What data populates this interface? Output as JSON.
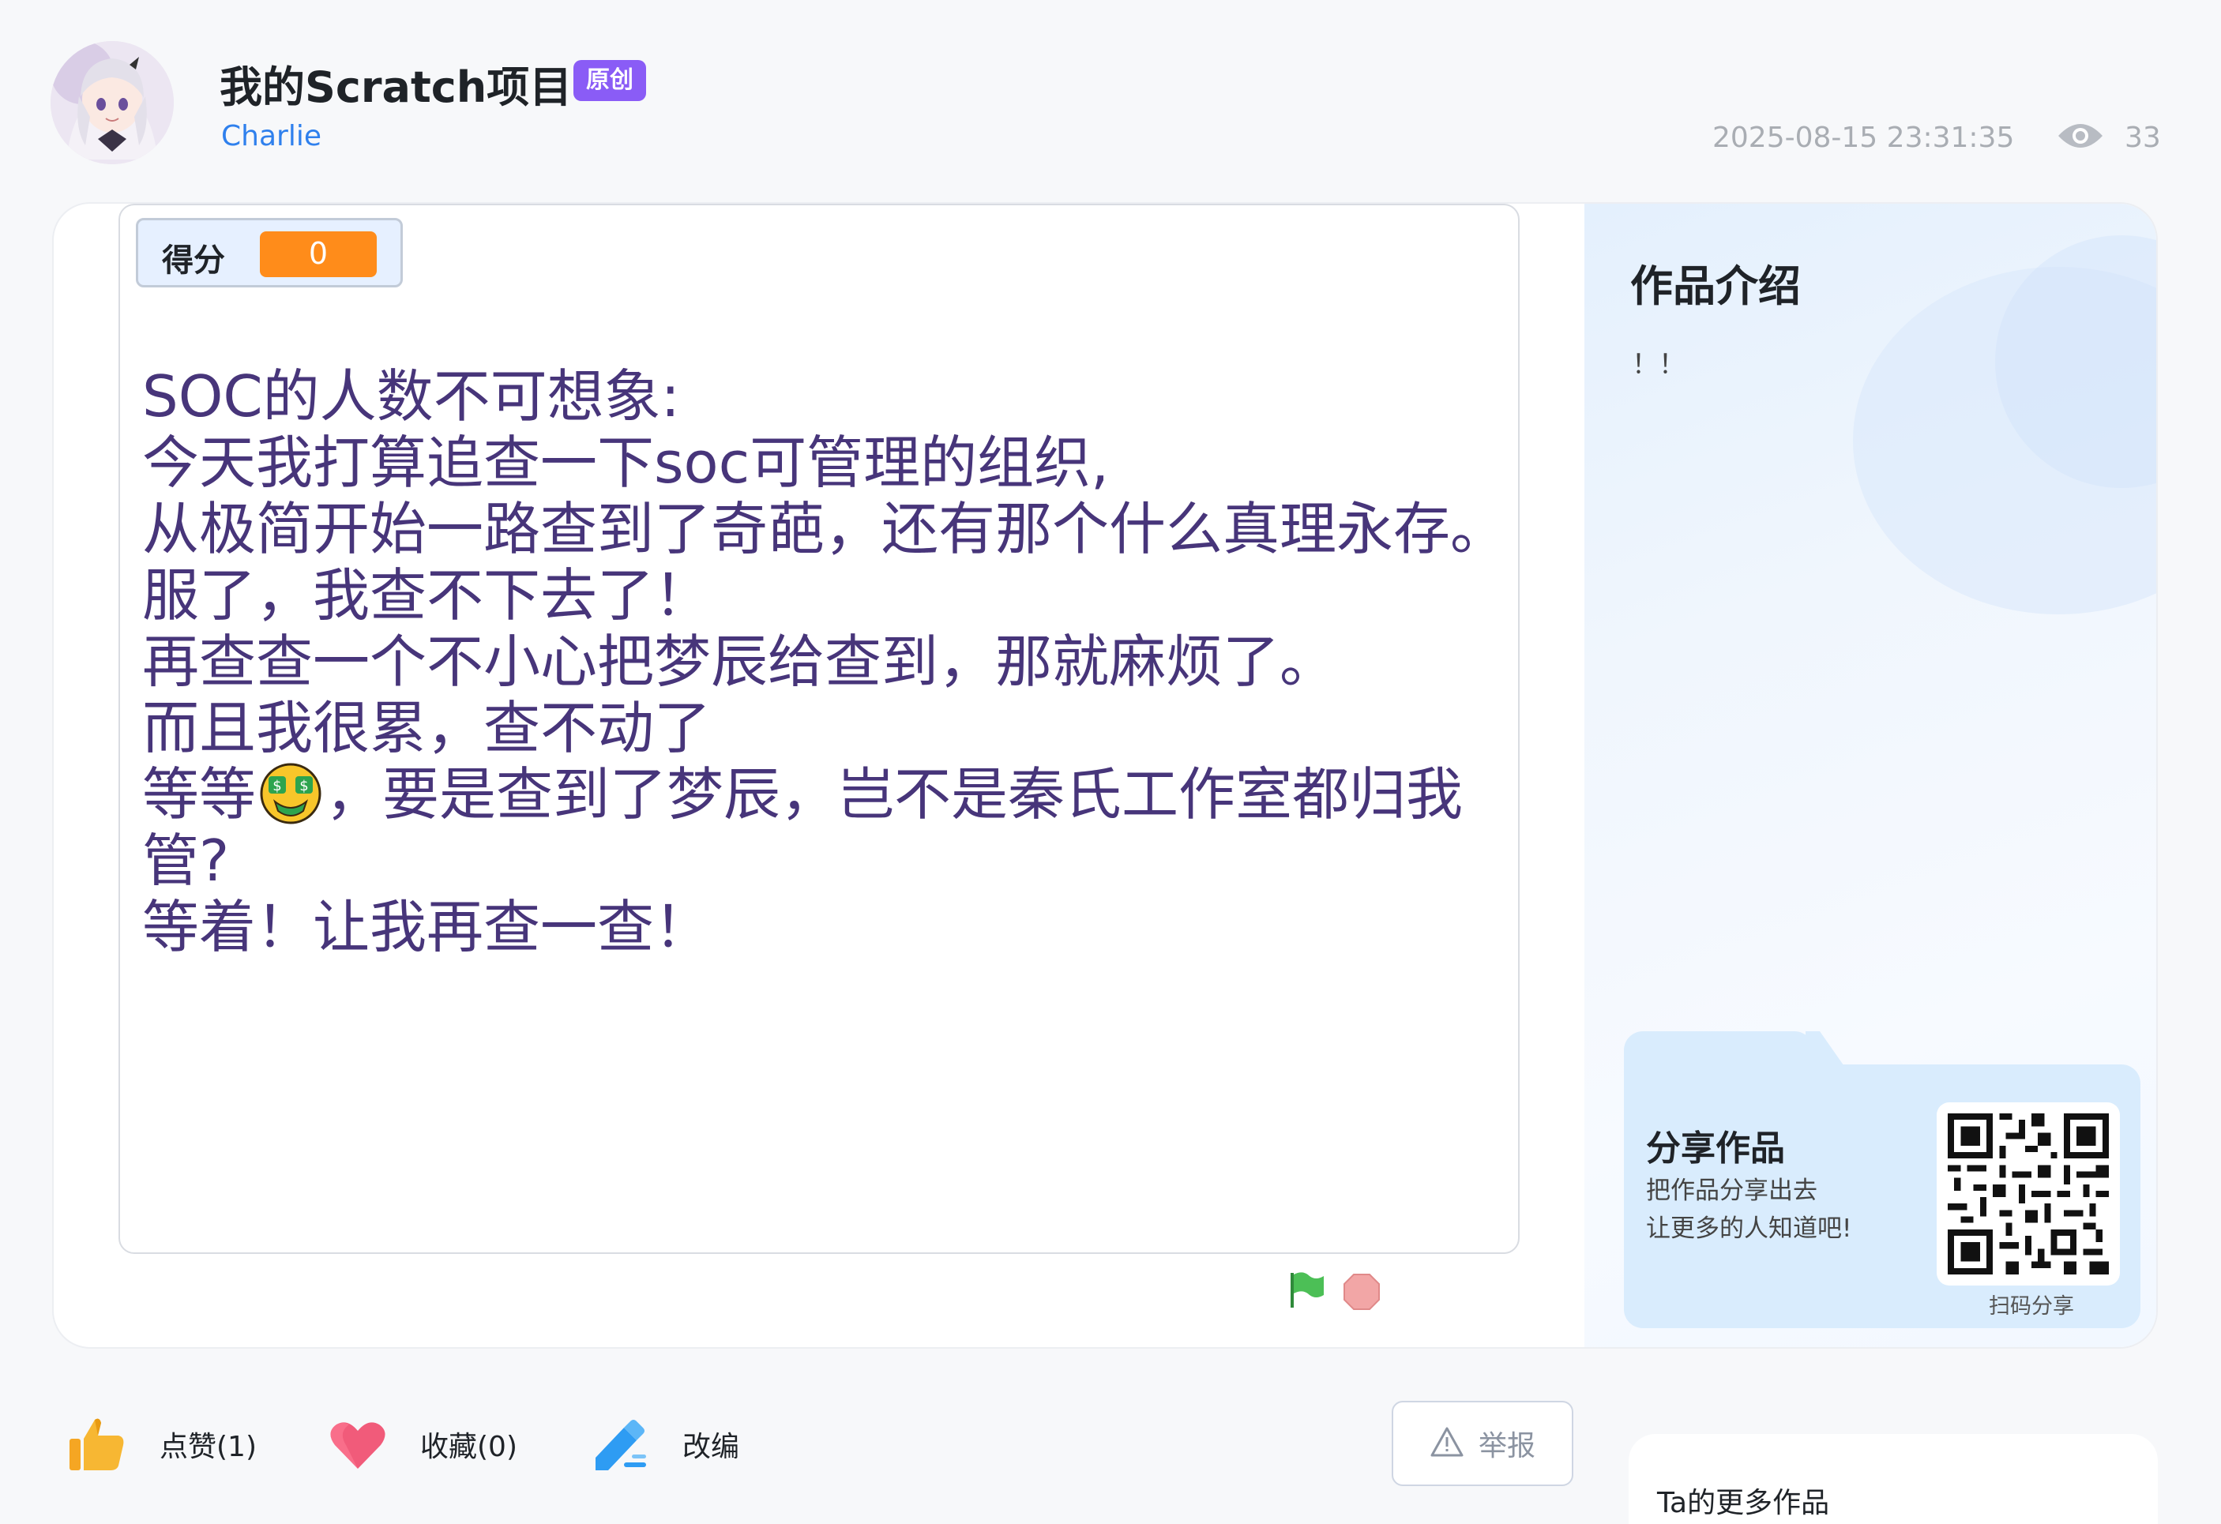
{
  "header": {
    "project_title": "我的Scratch项目",
    "tag_original": "原创",
    "author": "Charlie",
    "datetime": "2025-08-15 23:31:35",
    "view_count": "33"
  },
  "stage": {
    "score_label": "得分",
    "score_value": "0",
    "text_lines": [
      "SOC的人数不可想象:",
      "今天我打算追查一下soc可管理的组织,",
      "从极简开始一路查到了奇葩，还有那个什么真理永存。",
      "服了，我查不下去了！",
      "再查查一个不小心把梦辰给查到，那就麻烦了。",
      "而且我很累，查不动了",
      "等等",
      "，要是查到了梦辰，岂不是秦氏工作室都归我",
      "管?",
      "等着！让我再查一查！"
    ]
  },
  "intro": {
    "title": "作品介绍",
    "body": "！！"
  },
  "share": {
    "title": "分享作品",
    "line1": "把作品分享出去",
    "line2": "让更多的人知道吧!",
    "qr_caption": "扫码分享"
  },
  "actions": {
    "like": "点赞(1)",
    "favorite": "收藏(0)",
    "remix": "改编",
    "report": "举报"
  },
  "more_works": {
    "title": "Ta的更多作品"
  },
  "colors": {
    "accent_blue": "#2f80ed",
    "tag_purple": "#8a5cf6",
    "score_orange": "#ff8c1a",
    "stage_text": "#47357a"
  }
}
